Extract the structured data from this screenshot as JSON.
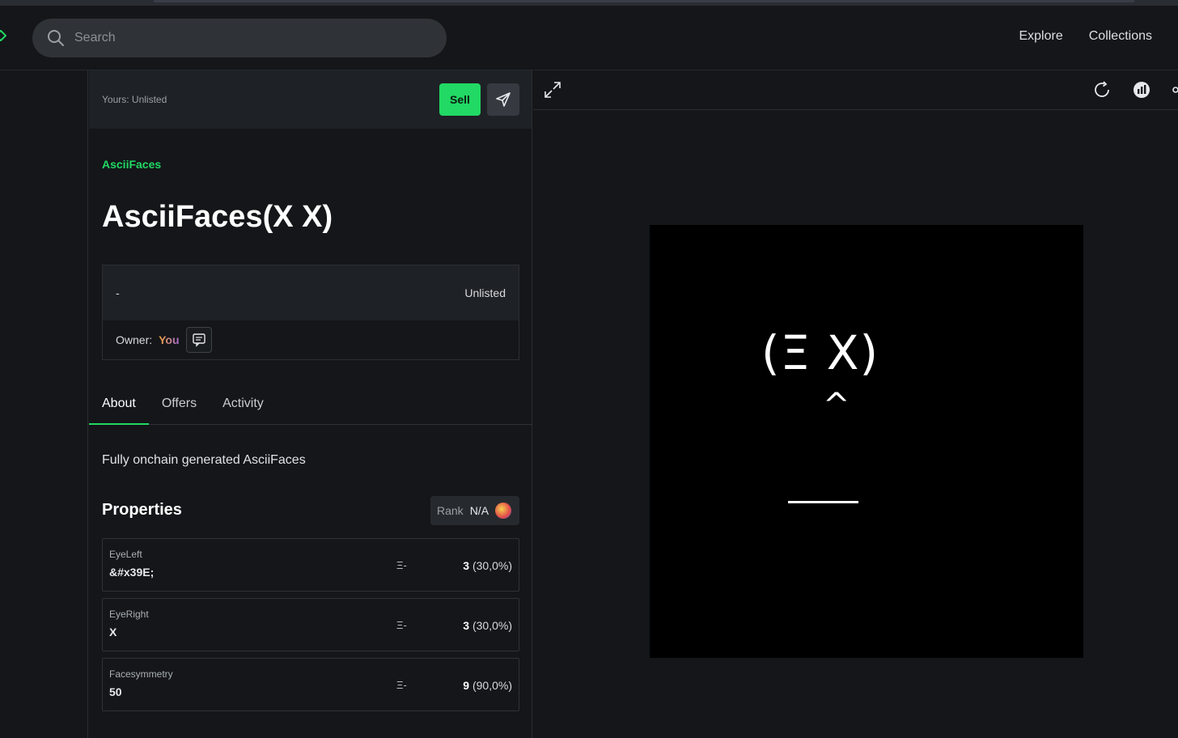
{
  "header": {
    "search_placeholder": "Search",
    "nav": [
      "Explore",
      "Collections"
    ]
  },
  "owner_bar": {
    "status": "Yours: Unlisted",
    "sell_label": "Sell"
  },
  "item": {
    "collection": "AsciiFaces",
    "title": "AsciiFaces(X X)",
    "price": "-",
    "listing_status": "Unlisted",
    "owner_label": "Owner:",
    "owner_value": "You"
  },
  "tabs": [
    "About",
    "Offers",
    "Activity"
  ],
  "about": {
    "description": "Fully onchain generated AsciiFaces"
  },
  "properties": {
    "title": "Properties",
    "rank_label": "Rank",
    "rank_value": "N/A",
    "items": [
      {
        "key": "EyeLeft",
        "value": "&#x39E;",
        "floor": "Ξ-",
        "count": "3",
        "pct": "(30,0%)"
      },
      {
        "key": "EyeRight",
        "value": "X",
        "floor": "Ξ-",
        "count": "3",
        "pct": "(30,0%)"
      },
      {
        "key": "Facesymmetry",
        "value": "50",
        "floor": "Ξ-",
        "count": "9",
        "pct": "(90,0%)"
      }
    ]
  },
  "artwork": {
    "eyes": "(Ξ X)",
    "nose": "^"
  },
  "colors": {
    "accent": "#21d964",
    "background": "#141619",
    "panel": "#1e2125"
  },
  "icons": [
    "search-icon",
    "send-icon",
    "chat-icon",
    "expand-icon",
    "refresh-icon",
    "chart-icon",
    "share-icon",
    "gem-icon"
  ]
}
